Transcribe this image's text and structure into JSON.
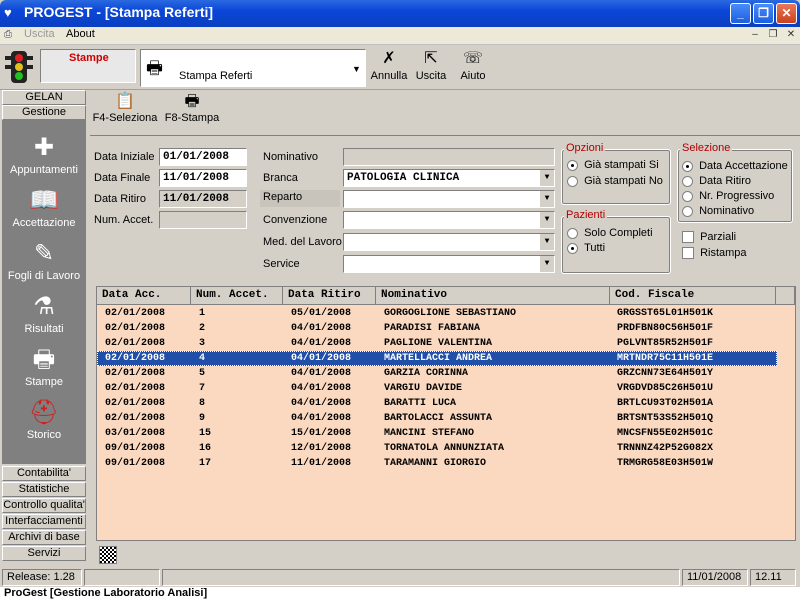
{
  "window": {
    "title": "PROGEST - [Stampa Referti]"
  },
  "menu": {
    "items": [
      "Uscita",
      "About"
    ]
  },
  "toolbar": {
    "module_label": "Stampe",
    "report_select": "Stampa Referti",
    "buttons": [
      {
        "label": "Annulla",
        "icon": "cancel-icon"
      },
      {
        "label": "Uscita",
        "icon": "exit-icon"
      },
      {
        "label": "Aiuto",
        "icon": "help-icon"
      }
    ]
  },
  "sidebar": {
    "headers": [
      "GELAN",
      "Gestione"
    ],
    "items": [
      {
        "label": "Appuntamenti",
        "icon": "calendar-icon"
      },
      {
        "label": "Accettazione",
        "icon": "book-icon"
      },
      {
        "label": "Fogli di Lavoro",
        "icon": "worksheet-icon"
      },
      {
        "label": "Risultati",
        "icon": "test-tubes-icon"
      },
      {
        "label": "Stampe",
        "icon": "printer-icon"
      },
      {
        "label": "Storico",
        "icon": "helmet-icon"
      }
    ],
    "bottom_sections": [
      "Contabilita'",
      "Statistiche",
      "Controllo qualita'",
      "Interfacciamenti",
      "Archivi di base",
      "Servizi"
    ]
  },
  "subtoolbar": {
    "select_label": "F4-Seleziona",
    "print_label": "F8-Stampa"
  },
  "form": {
    "data_iniziale_label": "Data Iniziale",
    "data_iniziale": "01/01/2008",
    "data_finale_label": "Data Finale",
    "data_finale": "11/01/2008",
    "data_ritiro_label": "Data Ritiro",
    "data_ritiro": "11/01/2008",
    "num_accet_label": "Num. Accet.",
    "num_accet": "",
    "nominativo_label": "Nominativo",
    "nominativo": "",
    "branca_label": "Branca",
    "branca": "PATOLOGIA CLINICA",
    "reparto_label": "Reparto",
    "reparto": "",
    "convenzione_label": "Convenzione",
    "convenzione": "",
    "med_lavoro_label": "Med. del Lavoro",
    "med_lavoro": "",
    "service_label": "Service",
    "service": ""
  },
  "opzioni": {
    "title": "Opzioni",
    "options": [
      {
        "label": "Già stampati Si",
        "selected": true
      },
      {
        "label": "Già stampati No",
        "selected": false
      }
    ]
  },
  "pazienti": {
    "title": "Pazienti",
    "options": [
      {
        "label": "Solo Completi",
        "selected": false
      },
      {
        "label": "Tutti",
        "selected": true
      }
    ]
  },
  "selezione": {
    "title": "Selezione",
    "options": [
      {
        "label": "Data Accettazione",
        "selected": true
      },
      {
        "label": "Data Ritiro",
        "selected": false
      },
      {
        "label": "Nr. Progressivo",
        "selected": false
      },
      {
        "label": "Nominativo",
        "selected": false
      }
    ]
  },
  "checks": [
    {
      "label": "Parziali",
      "checked": false
    },
    {
      "label": "Ristampa",
      "checked": false
    }
  ],
  "table": {
    "columns": [
      "Data Acc.",
      "Num. Accet.",
      "Data Ritiro",
      "Nominativo",
      "Cod. Fiscale"
    ],
    "selected_row": 3,
    "rows": [
      [
        "02/01/2008",
        "1",
        "05/01/2008",
        "GORGOGLIONE SEBASTIANO",
        "GRGSST65L01H501K"
      ],
      [
        "02/01/2008",
        "2",
        "04/01/2008",
        "PARADISI FABIANA",
        "PRDFBN80C56H501F"
      ],
      [
        "02/01/2008",
        "3",
        "04/01/2008",
        "PAGLIONE VALENTINA",
        "PGLVNT85R52H501F"
      ],
      [
        "02/01/2008",
        "4",
        "04/01/2008",
        "MARTELLACCI ANDREA",
        "MRTNDR75C11H501E"
      ],
      [
        "02/01/2008",
        "5",
        "04/01/2008",
        "GARZIA CORINNA",
        "GRZCNN73E64H501Y"
      ],
      [
        "02/01/2008",
        "7",
        "04/01/2008",
        "VARGIU DAVIDE",
        "VRGDVD85C26H501U"
      ],
      [
        "02/01/2008",
        "8",
        "04/01/2008",
        "BARATTI LUCA",
        "BRTLCU93T02H501A"
      ],
      [
        "02/01/2008",
        "9",
        "04/01/2008",
        "BARTOLACCI ASSUNTA",
        "BRTSNT53S52H501Q"
      ],
      [
        "03/01/2008",
        "15",
        "15/01/2008",
        "MANCINI STEFANO",
        "MNCSFN55E02H501C"
      ],
      [
        "09/01/2008",
        "16",
        "12/01/2008",
        "TORNATOLA ANNUNZIATA",
        "TRNNNZ42P52G082X"
      ],
      [
        "09/01/2008",
        "17",
        "11/01/2008",
        "TARAMANNI GIORGIO",
        "TRMGRG58E03H501W"
      ]
    ]
  },
  "status": {
    "release": "Release: 1.28",
    "date": "11/01/2008",
    "time": "12.11"
  },
  "footer": {
    "text": "ProGest [Gestione Laboratorio Analisi]"
  },
  "colors": {
    "title_blue": "#0a46d8",
    "grid_bg": "#fad9c0",
    "selected_row": "#1f4fa8",
    "group_title": "#b00000"
  }
}
